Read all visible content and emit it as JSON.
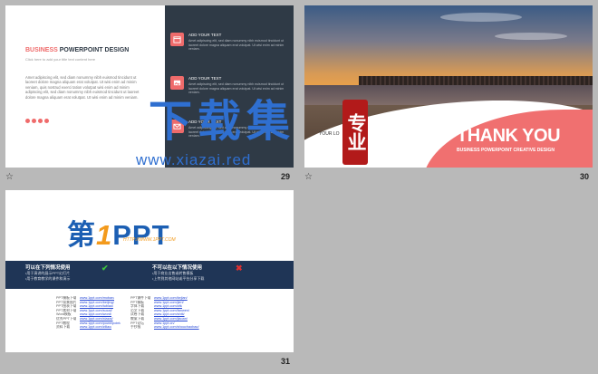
{
  "slides": [
    {
      "number": "29",
      "title_accent": "BUSINESS",
      "title_rest": " POWERPOINT DESIGN",
      "subtitle": "Click here to add your title text content here",
      "body": "Amet adipiscing elit, sed diam nonummy nibh euismod tincidunt ut laoreet dolore magna aliquam erat volutpat. Ut wisi enim ad minim veniam, quis nostrud exerci tation volutpat wisi enim ad minim adipiscing elit, sed diam nonummy nibh euismod tincidunt ut laoreet dolore magna aliquam erat volutpat. Ut wisi enim ad minim veniam.",
      "items": [
        {
          "icon": "calendar-icon",
          "heading": "ADD YOUR TEXT",
          "text": "Amet adipiscing elit, sed diam nonummy nibh euismod tincidunt ut laoreet dolore magna aliquam erat volutpat. Ut wisi enim ad minim veniam."
        },
        {
          "icon": "image-icon",
          "heading": "ADD YOUR TEXT",
          "text": "Amet adipiscing elit, sed diam nonummy nibh euismod tincidunt ut laoreet dolore magna aliquam erat volutpat. Ut wisi enim ad minim veniam."
        },
        {
          "icon": "mail-icon",
          "heading": "ADD YOUR TEXT",
          "text": "Amet adipiscing elit, sed diam nonummy nibh euismod tincidunt ut laoreet dolore magna aliquam erat volutpat. Ut wisi enim ad minim veniam."
        }
      ]
    },
    {
      "number": "30",
      "headline": "THANK YOU",
      "tagline": "BUSINESS POWERPOINT CREATIVE DESIGN",
      "logo_text": "YOUR LO"
    },
    {
      "number": "31",
      "brand_a": "第",
      "brand_one": "1",
      "brand_b": "PPT",
      "url": "HTTP://WWW.1PPT.COM",
      "allowed_heading": "可以在下列情况使用",
      "allowed_lines": [
        "•用于演讲的展示PPT幻灯片",
        "•用于教育教学的课件和演示"
      ],
      "forbidden_heading": "不可以在以下情况使用",
      "forbidden_lines": [
        "•用于商业出售或转售模板",
        "•上传到其他网站或平台分享下载"
      ],
      "links_left": [
        {
          "k": "PPT模板下载",
          "v": "www.1ppt.com/moban/"
        },
        {
          "k": "PPT背景图片",
          "v": "www.1ppt.com/beijing/"
        },
        {
          "k": "PPT图表下载",
          "v": "www.1ppt.com/tubiao/"
        },
        {
          "k": "PPT素材下载",
          "v": "www.1ppt.com/sucai/"
        },
        {
          "k": "Word模板",
          "v": "www.1ppt.com/word/"
        },
        {
          "k": "优秀PPT下载",
          "v": "www.1ppt.com/xiazai/"
        },
        {
          "k": "PPT教程",
          "v": "www.1ppt.com/powerpoint/"
        },
        {
          "k": "资料下载",
          "v": "www.1ppt.com/ziliao/"
        }
      ],
      "links_right": [
        {
          "k": "PPT课件下载",
          "v": "www.1ppt.com/kejian/"
        },
        {
          "k": "PPT模板",
          "v": "www.1ppt.com/jieri/"
        },
        {
          "k": "字体下载",
          "v": "www.1ppt.com/ziti/"
        },
        {
          "k": "范文下载",
          "v": "www.1ppt.com/fanwen/"
        },
        {
          "k": "试卷下载",
          "v": "www.1ppt.com/shiti/"
        },
        {
          "k": "教案下载",
          "v": "www.1ppt.com/jiaoan/"
        },
        {
          "k": "PPT论坛",
          "v": "www.1ppt.cn/"
        },
        {
          "k": "手抄报",
          "v": "www.1ppt.com/shouchaobao/"
        }
      ]
    }
  ],
  "watermark": {
    "title": "下载集",
    "url": "www.xiazai.red",
    "seal": "专业"
  },
  "colors": {
    "accent": "#ef6b6b",
    "dark": "#2f3a46",
    "brand_blue": "#1c5fb3",
    "brand_orange": "#f39a1c"
  }
}
